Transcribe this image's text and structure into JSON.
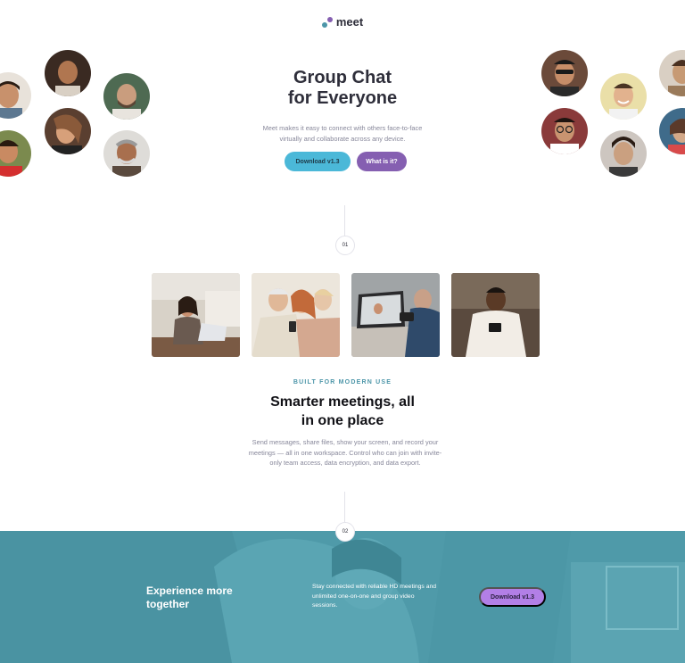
{
  "brand": {
    "name": "meet",
    "colors": {
      "purple": "#855fb1",
      "teal": "#4d96a9",
      "cyan": "#4bb8d8",
      "dark": "#2e2e3a"
    }
  },
  "hero": {
    "title_line1": "Group Chat",
    "title_line2": "for Everyone",
    "description": "Meet makes it easy to connect with others face-to-face virtually and collaborate across any device.",
    "download_label": "Download v1.3",
    "what_label": "What is it?"
  },
  "avatars_left": [
    "avatar-man-smiling",
    "avatar-woman-curly-hair",
    "avatar-man-beard",
    "avatar-woman-laughing",
    "avatar-man-red-shirt",
    "avatar-older-man"
  ],
  "avatars_right": [
    "avatar-man-sunglasses",
    "avatar-man-smiling-yellow",
    "avatar-man-edge",
    "avatar-man-glasses",
    "avatar-man-dark-hair",
    "avatar-woman-edge"
  ],
  "steps": {
    "one": "01",
    "two": "02"
  },
  "features": {
    "eyebrow": "BUILT FOR MODERN USE",
    "title_line1": "Smarter meetings, all",
    "title_line2": "in one place",
    "description": "Send messages, share files, show your screen, and record your meetings — all in one workspace. Control who can join with invite-only team access, data encryption, and data export.",
    "photos": [
      "woman-laptop-photo",
      "women-phone-photo",
      "man-video-call-photo",
      "man-phone-photo"
    ]
  },
  "banner": {
    "title_line1": "Experience more",
    "title_line2": "together",
    "description": "Stay connected with reliable HD meetings and unlimited one-on-one and group video sessions.",
    "download_label": "Download v1.3"
  }
}
